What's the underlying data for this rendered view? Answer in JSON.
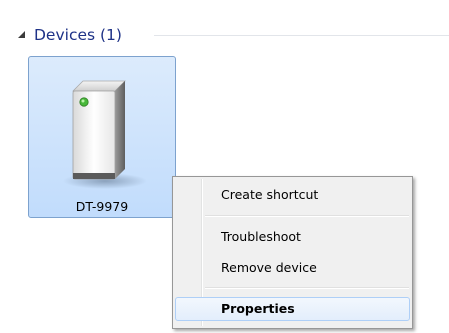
{
  "group": {
    "title": "Devices (1)",
    "collapse_icon": "collapse-triangle-icon"
  },
  "device": {
    "label": "DT-9979",
    "icon": "computer-tower-icon",
    "selected": true
  },
  "context_menu": {
    "items": [
      {
        "label": "Create shortcut",
        "bold": false,
        "highlighted": false
      },
      {
        "label": "Troubleshoot",
        "bold": false,
        "highlighted": false
      },
      {
        "label": "Remove device",
        "bold": false,
        "highlighted": false
      },
      {
        "label": "Properties",
        "bold": true,
        "highlighted": true
      }
    ]
  },
  "colors": {
    "group_title": "#1e3287",
    "selection_border": "#7da2ce",
    "selection_fill": "#c1dcfc",
    "menu_background": "#f0f0f0",
    "menu_highlight_border": "#aecff7"
  }
}
